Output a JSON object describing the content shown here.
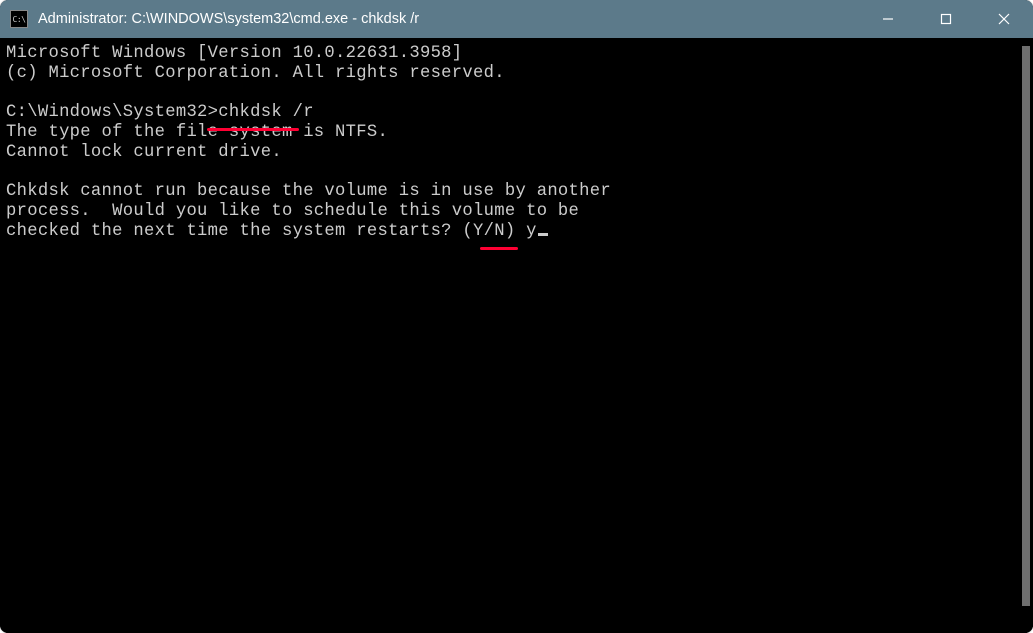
{
  "window": {
    "title": "Administrator: C:\\WINDOWS\\system32\\cmd.exe - chkdsk  /r",
    "app_icon_text": "C:\\"
  },
  "terminal": {
    "line1": "Microsoft Windows [Version 10.0.22631.3958]",
    "line2": "(c) Microsoft Corporation. All rights reserved.",
    "blank1": "",
    "prompt_line_prefix": "C:\\Windows\\System32>",
    "prompt_command": "chkdsk /r",
    "fs_line": "The type of the file system is NTFS.",
    "lock_line": "Cannot lock current drive.",
    "blank2": "",
    "msg_line1": "Chkdsk cannot run because the volume is in use by another",
    "msg_line2": "process.  Would you like to schedule this volume to be",
    "msg_line3_prefix": "checked the next time the system restarts? (Y/N) ",
    "user_input": "y"
  }
}
